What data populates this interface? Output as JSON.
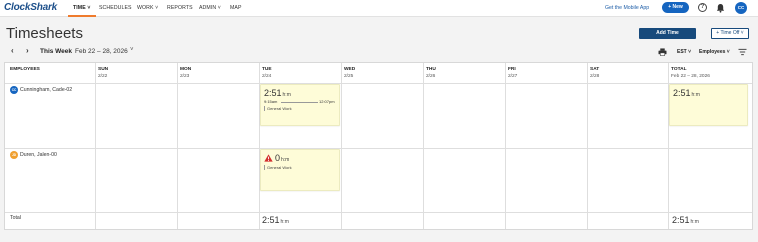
{
  "nav": {
    "logo": "ClockShark",
    "items": [
      "TIME ˅",
      "SCHEDULES",
      "WORK ˅",
      "REPORTS",
      "ADMIN ˅",
      "MAP"
    ],
    "mobile_link": "Get the Mobile App",
    "new_button": "+ New",
    "help_icon": "?",
    "user_initials": "CC"
  },
  "header": {
    "title": "Timesheets",
    "add_time": "Add Time",
    "time_off": "+ Time Off ˅",
    "prev_arrow": "‹",
    "next_arrow": "›",
    "week_label": "This Week",
    "week_range": "Feb 22 – 28, 2026",
    "week_caret": "˅",
    "timezone": "EST ˅",
    "employee_filter": "Employees ˅"
  },
  "columns": [
    {
      "name": "EMPLOYEES",
      "date": ""
    },
    {
      "name": "SUN",
      "date": "2/22"
    },
    {
      "name": "MON",
      "date": "2/23"
    },
    {
      "name": "TUE",
      "date": "2/24"
    },
    {
      "name": "WED",
      "date": "2/25"
    },
    {
      "name": "THU",
      "date": "2/26"
    },
    {
      "name": "FRI",
      "date": "2/27"
    },
    {
      "name": "SAT",
      "date": "2/28"
    },
    {
      "name": "TOTAL",
      "date": "Feb 22 – 28, 2026"
    }
  ],
  "employees": [
    {
      "initials": "CC",
      "color": "#1565c0",
      "name": "Cunningham, Cade-02",
      "tue": {
        "hours": "2:51",
        "unit": "h:m",
        "start": "9:15am",
        "end": "12:07pm",
        "job": "General Work"
      },
      "total": {
        "hours": "2:51",
        "unit": "h:m"
      }
    },
    {
      "initials": "JD",
      "color": "#f0a030",
      "name": "Duren, Jalen-00",
      "tue": {
        "hours": "0",
        "unit": "h:m",
        "job": "General Work",
        "warning": true
      }
    }
  ],
  "totals": {
    "label": "Total",
    "tue": "2:51",
    "week": "2:51",
    "unit": "h:m"
  },
  "colors": {
    "brand": "#1c4f8a",
    "accent": "#ef7b2d",
    "primary_button": "#174a7c",
    "card_bg": "#fefcd8",
    "warning": "#d32f2f"
  }
}
